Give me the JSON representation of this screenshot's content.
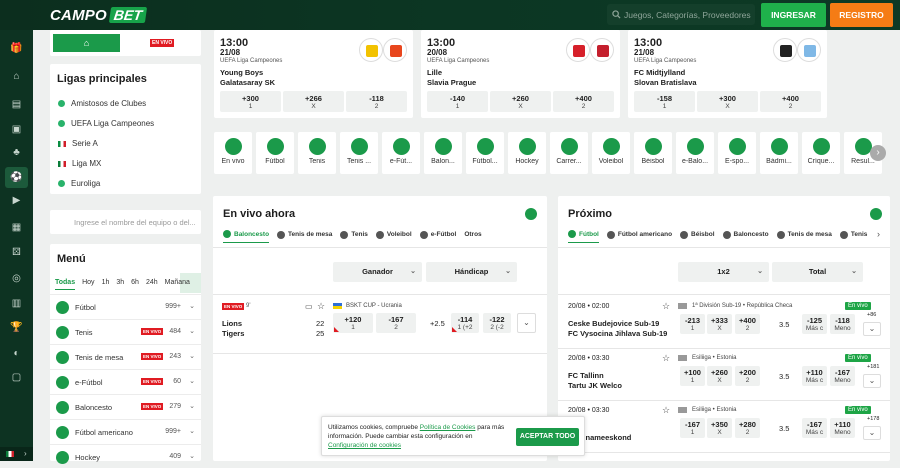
{
  "header": {
    "logo_a": "CAMPO",
    "logo_b": "BET",
    "search_placeholder": "Juegos, Categorías, Proveedores",
    "login": "INGRESAR",
    "register": "REGISTRO"
  },
  "left": {
    "live_tag": "EN VIVO",
    "leagues_title": "Ligas principales",
    "leagues": [
      "Amistosos de Clubes",
      "UEFA Liga Campeones",
      "Serie A",
      "Liga MX",
      "Euroliga"
    ],
    "team_search_placeholder": "Ingrese el nombre del equipo o del...",
    "menu_title": "Menú",
    "time_filters": [
      "Todas",
      "Hoy",
      "1h",
      "3h",
      "6h",
      "24h",
      "Mañana"
    ],
    "menu": [
      {
        "name": "Fútbol",
        "count": "999+",
        "live": false
      },
      {
        "name": "Tenis",
        "count": "484",
        "live": true
      },
      {
        "name": "Tenis de mesa",
        "count": "243",
        "live": true
      },
      {
        "name": "e-Fútbol",
        "count": "60",
        "live": true
      },
      {
        "name": "Baloncesto",
        "count": "279",
        "live": true
      },
      {
        "name": "Fútbol americano",
        "count": "999+",
        "live": false
      },
      {
        "name": "Hockey",
        "count": "409",
        "live": false
      }
    ]
  },
  "featured": [
    {
      "time": "13:00",
      "date": "21/08",
      "league": "UEFA Liga Campeones",
      "home": "Young Boys",
      "away": "Galatasaray SK",
      "odds": [
        {
          "v": "+300",
          "l": "1"
        },
        {
          "v": "+266",
          "l": "X"
        },
        {
          "v": "-118",
          "l": "2"
        }
      ],
      "c1": "#f2c200",
      "c2": "#e8461d"
    },
    {
      "time": "13:00",
      "date": "20/08",
      "league": "UEFA Liga Campeones",
      "home": "Lille",
      "away": "Slavia Prague",
      "odds": [
        {
          "v": "-140",
          "l": "1"
        },
        {
          "v": "+260",
          "l": "X"
        },
        {
          "v": "+400",
          "l": "2"
        }
      ],
      "c1": "#d6202a",
      "c2": "#c41f2d"
    },
    {
      "time": "13:00",
      "date": "21/08",
      "league": "UEFA Liga Campeones",
      "home": "FC Midtjylland",
      "away": "Slovan Bratislava",
      "odds": [
        {
          "v": "-158",
          "l": "1"
        },
        {
          "v": "+300",
          "l": "X"
        },
        {
          "v": "+400",
          "l": "2"
        }
      ],
      "c1": "#222222",
      "c2": "#7fb8e6"
    }
  ],
  "sports": [
    "En vivo",
    "Fútbol",
    "Tenis",
    "Tenis ...",
    "e-Fút...",
    "Balon...",
    "Fútbol...",
    "Hockey",
    "Carrer...",
    "Voleibol",
    "Béisbol",
    "e-Balo...",
    "E-spo...",
    "Bádmi...",
    "Críque...",
    "Resul..."
  ],
  "live": {
    "title": "En vivo ahora",
    "tabs": [
      "Baloncesto",
      "Tenis de mesa",
      "Tenis",
      "Voleibol",
      "e-Fútbol",
      "Otros"
    ],
    "sel1": "Ganador",
    "sel2": "Hándicap",
    "match": {
      "badge": "EN VIVO",
      "period": "9'",
      "league": "BSKT CUP - Ucrania",
      "home": "Lions",
      "away": "Tigers",
      "hs": "22",
      "as": "25",
      "o1": "+120",
      "o1l": "1",
      "o2": "-167",
      "o2l": "2",
      "line": "+2.5",
      "h1": "-114",
      "h1l": "1 (+2",
      "h2": "-122",
      "h2l": "2 (-2"
    }
  },
  "next": {
    "title": "Próximo",
    "tabs": [
      "Fútbol",
      "Fútbol americano",
      "Béisbol",
      "Baloncesto",
      "Tenis de mesa",
      "Tenis"
    ],
    "sel1": "1x2",
    "sel2": "Total",
    "live_label": "En vivo",
    "matches": [
      {
        "dt": "20/08 • 02:00",
        "league": "1ª División Sub-19 • República Checa",
        "home": "Ceske Budejovice Sub-19",
        "away": "FC Vysocina Jihlava Sub-19",
        "o": [
          "-213",
          "+333",
          "+400"
        ],
        "l": [
          "1",
          "X",
          "2"
        ],
        "tot": "3.5",
        "t1": "-125",
        "t1l": "Más c",
        "t2": "-118",
        "t2l": "Meno",
        "more": "+86"
      },
      {
        "dt": "20/08 • 03:30",
        "league": "Esiliiga • Estonia",
        "home": "FC Tallinn",
        "away": "Tartu JK Welco",
        "o": [
          "+100",
          "+260",
          "+200"
        ],
        "l": [
          "1",
          "X",
          "2"
        ],
        "tot": "3.5",
        "t1": "+110",
        "t1l": "Más c",
        "t2": "-167",
        "t2l": "Meno",
        "more": "+181"
      },
      {
        "dt": "20/08 • 03:30",
        "league": "Esiliiga • Estonia",
        "home": "lva",
        "away": "e Linnameeskond",
        "o": [
          "-167",
          "+350",
          "+280"
        ],
        "l": [
          "1",
          "X",
          "2"
        ],
        "tot": "3.5",
        "t1": "-167",
        "t1l": "Más c",
        "t2": "+110",
        "t2l": "Meno",
        "more": "+178"
      }
    ]
  },
  "cookie": {
    "pre": "Utilizamos cookies, compruebe ",
    "link": "Política de Cookies",
    "mid": " para más información. Puede cambiar esta configuración en ",
    "link2": "Configuración de cookies",
    "accept": "ACEPTAR TODO"
  }
}
